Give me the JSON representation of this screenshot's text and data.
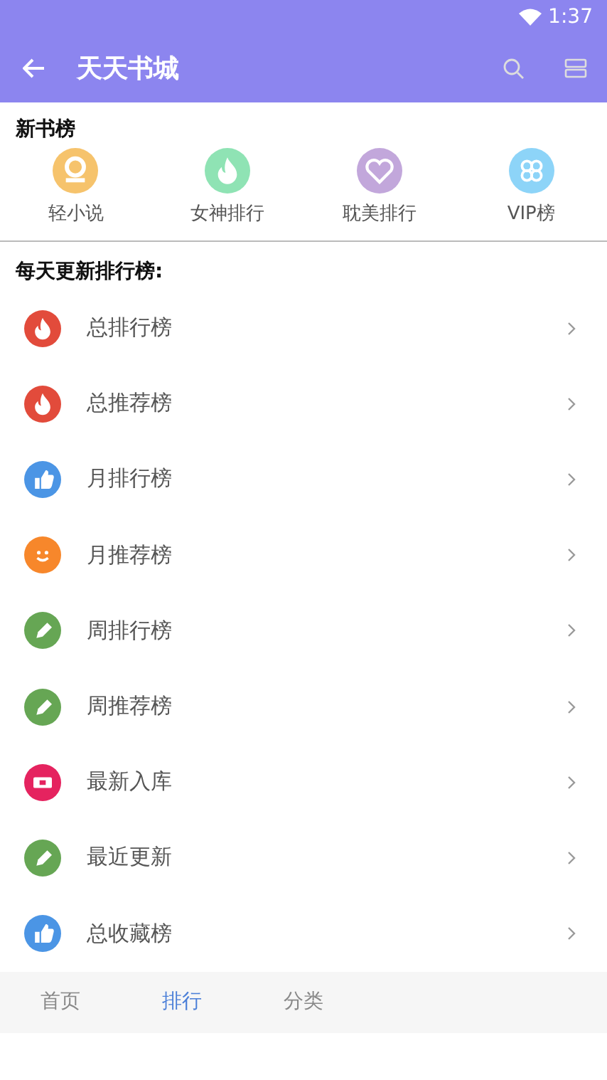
{
  "status_bar": {
    "time": "1:37"
  },
  "toolbar": {
    "title": "天天书城"
  },
  "new_books": {
    "heading": "新书榜",
    "items": [
      {
        "label": "轻小说",
        "kind": "badge",
        "color": "#f6c36c"
      },
      {
        "label": "女神排行",
        "kind": "flame",
        "color": "#8fe3b4"
      },
      {
        "label": "耽美排行",
        "kind": "heart",
        "color": "#c2a7db"
      },
      {
        "label": "VIP榜",
        "kind": "clover",
        "color": "#8dd4f8"
      }
    ]
  },
  "rankings": {
    "heading": "每天更新排行榜:",
    "items": [
      {
        "label": "总排行榜",
        "kind": "flame",
        "color": "#e24b3b"
      },
      {
        "label": "总推荐榜",
        "kind": "flame",
        "color": "#e24b3b"
      },
      {
        "label": "月排行榜",
        "kind": "thumb",
        "color": "#4b95e5"
      },
      {
        "label": "月推荐榜",
        "kind": "smile",
        "color": "#f7872b"
      },
      {
        "label": "周排行榜",
        "kind": "pen",
        "color": "#66a654"
      },
      {
        "label": "周推荐榜",
        "kind": "pen",
        "color": "#66a654"
      },
      {
        "label": "最新入库",
        "kind": "ticket",
        "color": "#e5235f"
      },
      {
        "label": "最近更新",
        "kind": "pen",
        "color": "#66a654"
      },
      {
        "label": "总收藏榜",
        "kind": "thumb",
        "color": "#4b95e5"
      }
    ]
  },
  "bottom_nav": [
    {
      "label": "首页",
      "selected": false
    },
    {
      "label": "排行",
      "selected": true
    },
    {
      "label": "分类",
      "selected": false
    }
  ]
}
